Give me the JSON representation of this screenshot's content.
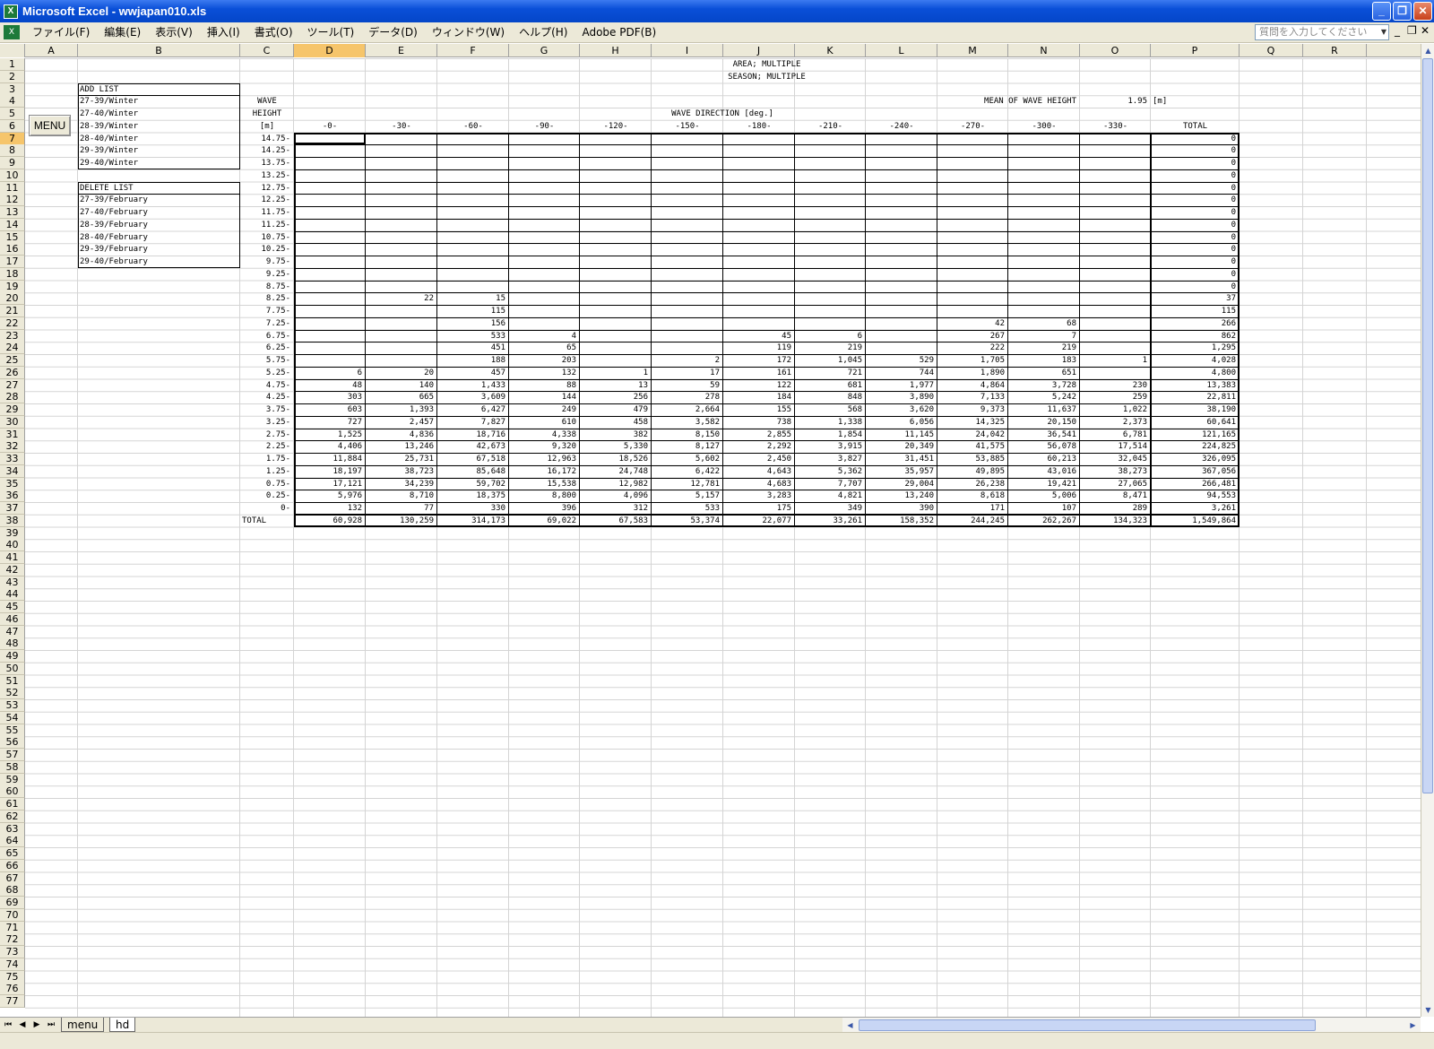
{
  "window": {
    "title": "Microsoft Excel - wwjapan010.xls",
    "app_icon": "excel-icon"
  },
  "menu": [
    "ファイル(F)",
    "編集(E)",
    "表示(V)",
    "挿入(I)",
    "書式(O)",
    "ツール(T)",
    "データ(D)",
    "ウィンドウ(W)",
    "ヘルプ(H)",
    "Adobe PDF(B)"
  ],
  "help_placeholder": "質問を入力してください",
  "columns": [
    "A",
    "B",
    "C",
    "D",
    "E",
    "F",
    "G",
    "H",
    "I",
    "J",
    "K",
    "L",
    "M",
    "N",
    "O",
    "P",
    "Q",
    "R"
  ],
  "selected_column": "D",
  "selected_row": 7,
  "menu_button": "MENU",
  "header": {
    "area": "AREA; MULTIPLE",
    "season": "SEASON; MULTIPLE",
    "wave": "WAVE",
    "height": "HEIGHT",
    "unit": "[m]",
    "mean_label": "MEAN OF WAVE HEIGHT",
    "mean_value": "1.95",
    "mean_unit": "[m]",
    "direction_label": "WAVE DIRECTION [deg.]"
  },
  "add_list": {
    "title": "ADD LIST",
    "items": [
      "27-39/Winter",
      "27-40/Winter",
      "28-39/Winter",
      "28-40/Winter",
      "29-39/Winter",
      "29-40/Winter"
    ]
  },
  "delete_list": {
    "title": "DELETE LIST",
    "items": [
      "27-39/February",
      "27-40/February",
      "28-39/February",
      "28-40/February",
      "29-39/February",
      "29-40/February"
    ]
  },
  "directions": [
    "-0-",
    "-30-",
    "-60-",
    "-90-",
    "-120-",
    "-150-",
    "-180-",
    "-210-",
    "-240-",
    "-270-",
    "-300-",
    "-330-",
    "TOTAL"
  ],
  "table_rows": [
    {
      "h": "14.75-",
      "v": [
        "",
        "",
        "",
        "",
        "",
        "",
        "",
        "",
        "",
        "",
        "",
        "",
        "0"
      ]
    },
    {
      "h": "14.25-",
      "v": [
        "",
        "",
        "",
        "",
        "",
        "",
        "",
        "",
        "",
        "",
        "",
        "",
        "0"
      ]
    },
    {
      "h": "13.75-",
      "v": [
        "",
        "",
        "",
        "",
        "",
        "",
        "",
        "",
        "",
        "",
        "",
        "",
        "0"
      ]
    },
    {
      "h": "13.25-",
      "v": [
        "",
        "",
        "",
        "",
        "",
        "",
        "",
        "",
        "",
        "",
        "",
        "",
        "0"
      ]
    },
    {
      "h": "12.75-",
      "v": [
        "",
        "",
        "",
        "",
        "",
        "",
        "",
        "",
        "",
        "",
        "",
        "",
        "0"
      ]
    },
    {
      "h": "12.25-",
      "v": [
        "",
        "",
        "",
        "",
        "",
        "",
        "",
        "",
        "",
        "",
        "",
        "",
        "0"
      ]
    },
    {
      "h": "11.75-",
      "v": [
        "",
        "",
        "",
        "",
        "",
        "",
        "",
        "",
        "",
        "",
        "",
        "",
        "0"
      ]
    },
    {
      "h": "11.25-",
      "v": [
        "",
        "",
        "",
        "",
        "",
        "",
        "",
        "",
        "",
        "",
        "",
        "",
        "0"
      ]
    },
    {
      "h": "10.75-",
      "v": [
        "",
        "",
        "",
        "",
        "",
        "",
        "",
        "",
        "",
        "",
        "",
        "",
        "0"
      ]
    },
    {
      "h": "10.25-",
      "v": [
        "",
        "",
        "",
        "",
        "",
        "",
        "",
        "",
        "",
        "",
        "",
        "",
        "0"
      ]
    },
    {
      "h": "9.75-",
      "v": [
        "",
        "",
        "",
        "",
        "",
        "",
        "",
        "",
        "",
        "",
        "",
        "",
        "0"
      ]
    },
    {
      "h": "9.25-",
      "v": [
        "",
        "",
        "",
        "",
        "",
        "",
        "",
        "",
        "",
        "",
        "",
        "",
        "0"
      ]
    },
    {
      "h": "8.75-",
      "v": [
        "",
        "",
        "",
        "",
        "",
        "",
        "",
        "",
        "",
        "",
        "",
        "",
        "0"
      ]
    },
    {
      "h": "8.25-",
      "v": [
        "",
        "22",
        "15",
        "",
        "",
        "",
        "",
        "",
        "",
        "",
        "",
        "",
        "37"
      ]
    },
    {
      "h": "7.75-",
      "v": [
        "",
        "",
        "115",
        "",
        "",
        "",
        "",
        "",
        "",
        "",
        "",
        "",
        "115"
      ]
    },
    {
      "h": "7.25-",
      "v": [
        "",
        "",
        "156",
        "",
        "",
        "",
        "",
        "",
        "",
        "42",
        "68",
        "",
        "266"
      ]
    },
    {
      "h": "6.75-",
      "v": [
        "",
        "",
        "533",
        "4",
        "",
        "",
        "45",
        "6",
        "",
        "267",
        "7",
        "",
        "862"
      ]
    },
    {
      "h": "6.25-",
      "v": [
        "",
        "",
        "451",
        "65",
        "",
        "",
        "119",
        "219",
        "",
        "222",
        "219",
        "",
        "1,295"
      ]
    },
    {
      "h": "5.75-",
      "v": [
        "",
        "",
        "188",
        "203",
        "",
        "2",
        "172",
        "1,045",
        "529",
        "1,705",
        "183",
        "1",
        "4,028"
      ]
    },
    {
      "h": "5.25-",
      "v": [
        "6",
        "20",
        "457",
        "132",
        "1",
        "17",
        "161",
        "721",
        "744",
        "1,890",
        "651",
        "",
        "4,800"
      ]
    },
    {
      "h": "4.75-",
      "v": [
        "48",
        "140",
        "1,433",
        "88",
        "13",
        "59",
        "122",
        "681",
        "1,977",
        "4,864",
        "3,728",
        "230",
        "13,383"
      ]
    },
    {
      "h": "4.25-",
      "v": [
        "303",
        "665",
        "3,609",
        "144",
        "256",
        "278",
        "184",
        "848",
        "3,890",
        "7,133",
        "5,242",
        "259",
        "22,811"
      ]
    },
    {
      "h": "3.75-",
      "v": [
        "603",
        "1,393",
        "6,427",
        "249",
        "479",
        "2,664",
        "155",
        "568",
        "3,620",
        "9,373",
        "11,637",
        "1,022",
        "38,190"
      ]
    },
    {
      "h": "3.25-",
      "v": [
        "727",
        "2,457",
        "7,827",
        "610",
        "458",
        "3,582",
        "738",
        "1,338",
        "6,056",
        "14,325",
        "20,150",
        "2,373",
        "60,641"
      ]
    },
    {
      "h": "2.75-",
      "v": [
        "1,525",
        "4,836",
        "18,716",
        "4,338",
        "382",
        "8,150",
        "2,855",
        "1,854",
        "11,145",
        "24,042",
        "36,541",
        "6,781",
        "121,165"
      ]
    },
    {
      "h": "2.25-",
      "v": [
        "4,406",
        "13,246",
        "42,673",
        "9,320",
        "5,330",
        "8,127",
        "2,292",
        "3,915",
        "20,349",
        "41,575",
        "56,078",
        "17,514",
        "224,825"
      ]
    },
    {
      "h": "1.75-",
      "v": [
        "11,884",
        "25,731",
        "67,518",
        "12,963",
        "18,526",
        "5,602",
        "2,450",
        "3,827",
        "31,451",
        "53,885",
        "60,213",
        "32,045",
        "326,095"
      ]
    },
    {
      "h": "1.25-",
      "v": [
        "18,197",
        "38,723",
        "85,648",
        "16,172",
        "24,748",
        "6,422",
        "4,643",
        "5,362",
        "35,957",
        "49,895",
        "43,016",
        "38,273",
        "367,056"
      ]
    },
    {
      "h": "0.75-",
      "v": [
        "17,121",
        "34,239",
        "59,702",
        "15,538",
        "12,982",
        "12,781",
        "4,683",
        "7,707",
        "29,004",
        "26,238",
        "19,421",
        "27,065",
        "266,481"
      ]
    },
    {
      "h": "0.25-",
      "v": [
        "5,976",
        "8,710",
        "18,375",
        "8,800",
        "4,096",
        "5,157",
        "3,283",
        "4,821",
        "13,240",
        "8,618",
        "5,006",
        "8,471",
        "94,553"
      ]
    },
    {
      "h": "0-",
      "v": [
        "132",
        "77",
        "330",
        "396",
        "312",
        "533",
        "175",
        "349",
        "390",
        "171",
        "107",
        "289",
        "3,261"
      ]
    }
  ],
  "total_row": {
    "label": "TOTAL",
    "v": [
      "60,928",
      "130,259",
      "314,173",
      "69,022",
      "67,583",
      "53,374",
      "22,077",
      "33,261",
      "158,352",
      "244,245",
      "262,267",
      "134,323",
      "1,549,864"
    ]
  },
  "sheet_tabs": [
    "menu",
    "hd"
  ],
  "active_sheet": "hd",
  "row_count": 77
}
